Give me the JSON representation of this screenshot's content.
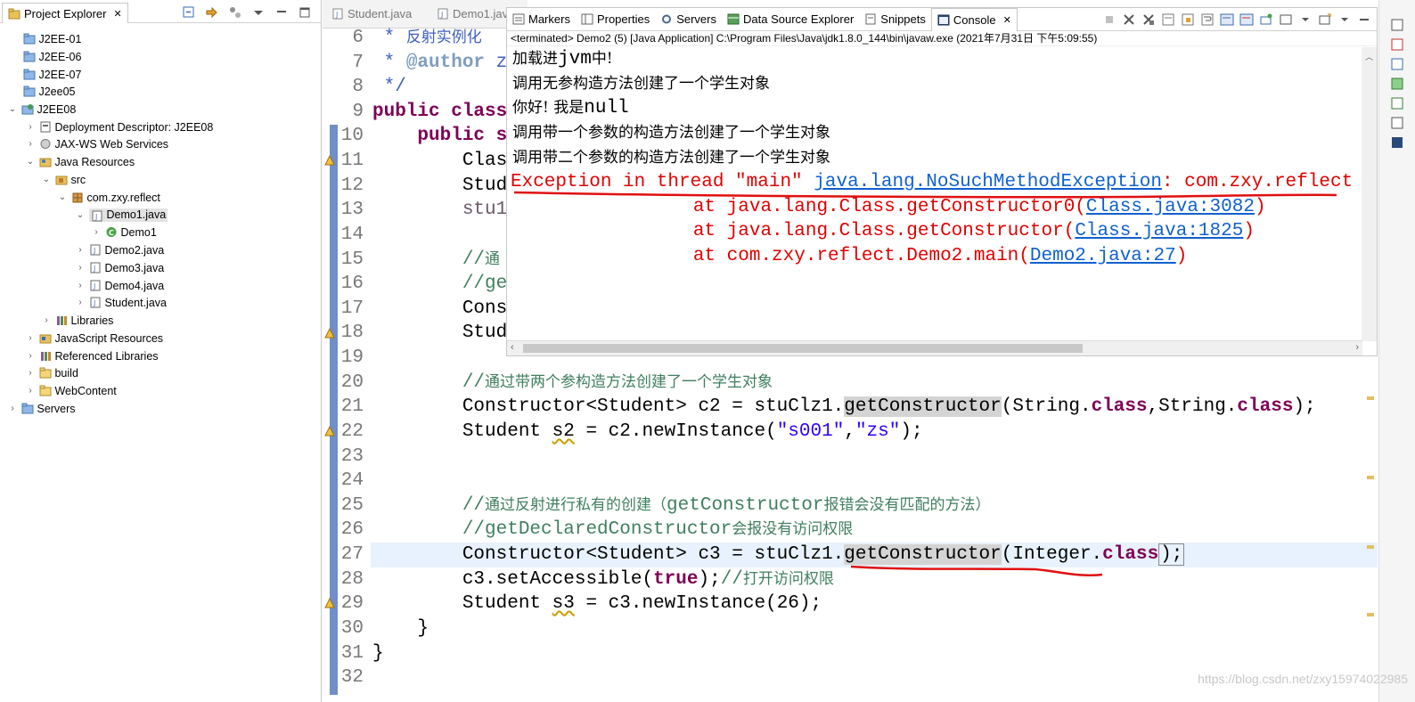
{
  "project_explorer": {
    "tab_label": "Project Explorer",
    "items": [
      {
        "label": "J2EE-01"
      },
      {
        "label": "J2EE-06"
      },
      {
        "label": "J2EE-07"
      },
      {
        "label": "J2ee05"
      },
      {
        "label": "J2EE08"
      },
      {
        "label": "Deployment Descriptor: J2EE08"
      },
      {
        "label": "JAX-WS Web Services"
      },
      {
        "label": "Java Resources"
      },
      {
        "label": "src"
      },
      {
        "label": "com.zxy.reflect"
      },
      {
        "label": "Demo1.java"
      },
      {
        "label": "Demo1"
      },
      {
        "label": "Demo2.java"
      },
      {
        "label": "Demo3.java"
      },
      {
        "label": "Demo4.java"
      },
      {
        "label": "Student.java"
      },
      {
        "label": "Libraries"
      },
      {
        "label": "JavaScript Resources"
      },
      {
        "label": "Referenced Libraries"
      },
      {
        "label": "build"
      },
      {
        "label": "WebContent"
      },
      {
        "label": "Servers"
      }
    ]
  },
  "editor": {
    "tabs": [
      {
        "label": "Student.java"
      },
      {
        "label": "Demo1.java"
      }
    ],
    "line_numbers": [
      "6",
      "7",
      "8",
      "9",
      "10",
      "11",
      "12",
      "13",
      "14",
      "15",
      "16",
      "17",
      "18",
      "19",
      "20",
      "21",
      "22",
      "23",
      "24",
      "25",
      "26",
      "27",
      "28",
      "29",
      "30",
      "31",
      "32"
    ]
  },
  "console": {
    "tabs": [
      {
        "label": "Markers"
      },
      {
        "label": "Properties"
      },
      {
        "label": "Servers"
      },
      {
        "label": "Data Source Explorer"
      },
      {
        "label": "Snippets"
      },
      {
        "label": "Console"
      }
    ],
    "status": "<terminated> Demo2 (5) [Java Application] C:\\Program Files\\Java\\jdk1.8.0_144\\bin\\javaw.exe (2021年7月31日 下午5:09:55)",
    "output": {
      "l1_a": "加载进",
      "l1_b": "jvm",
      "l1_c": "中!",
      "l2": "调用无参构造方法创建了一个学生对象",
      "l3_a": "你好! 我是",
      "l3_b": "null",
      "l4": "调用带一个参数的构造方法创建了一个学生对象",
      "l5": "调用带二个参数的构造方法创建了一个学生对象",
      "e1_a": "Exception in thread \"main\" ",
      "e1_link": "java.lang.NoSuchMethodException",
      "e1_b": ": com.zxy.reflect",
      "e2_a": "\tat java.lang.Class.getConstructor0(",
      "e2_link": "Class.java:3082",
      "e2_b": ")",
      "e3_a": "\tat java.lang.Class.getConstructor(",
      "e3_link": "Class.java:1825",
      "e3_b": ")",
      "e4_a": "\tat com.zxy.reflect.Demo2.main(",
      "e4_link": "Demo2.java:27",
      "e4_b": ")"
    }
  },
  "code": {
    "l6_a": " * ",
    "l6_b": "反射实例化",
    "l7_a": " * ",
    "l7_b": "@author",
    "l7_c": " z",
    "l8": " */",
    "l9_kw": "public class",
    "l10_kw": "    public s",
    "l11": "        Clas",
    "l12": "        Stud",
    "l13": "        stu1",
    "l15_a": "        //",
    "l15_b": "通",
    "l16": "        //ge",
    "l17": "        Cons",
    "l18": "        Stud",
    "l20_a": "        //",
    "l20_b": "通过带两个参构造方法创建了一个学生对象",
    "l21_a": "        Constructor<Student> c2 = stuClz1.",
    "l21_hl": "getConstructor",
    "l21_b": "(String.",
    "l21_kw1": "class",
    "l21_c": ",String.",
    "l21_kw2": "class",
    "l21_d": ");",
    "l22_a": "        Student ",
    "l22_var": "s2",
    "l22_b": " = c2.newInstance(",
    "l22_s1": "\"s001\"",
    "l22_c": ",",
    "l22_s2": "\"zs\"",
    "l22_d": ");",
    "l25_a": "        //",
    "l25_b": "通过反射进行私有的创建（",
    "l25_c": "getConstructor",
    "l25_d": "报错会没有匹配的方法）",
    "l26_a": "        //getDeclaredConstructor",
    "l26_b": "会报没有访问权限",
    "l27_a": "        Constructor<Student> c3 = stuClz1.",
    "l27_hl": "getConstructor",
    "l27_b": "(Integer.",
    "l27_kw": "class",
    "l27_c": ");",
    "l28_a": "        c3.setAccessible(",
    "l28_kw": "true",
    "l28_b": ");",
    "l28_c": "//",
    "l28_d": "打开访问权限",
    "l29_a": "        Student ",
    "l29_var": "s3",
    "l29_b": " = c3.newInstance(26);",
    "l30": "    }",
    "l31": "}"
  },
  "watermark": "https://blog.csdn.net/zxy15974022985"
}
